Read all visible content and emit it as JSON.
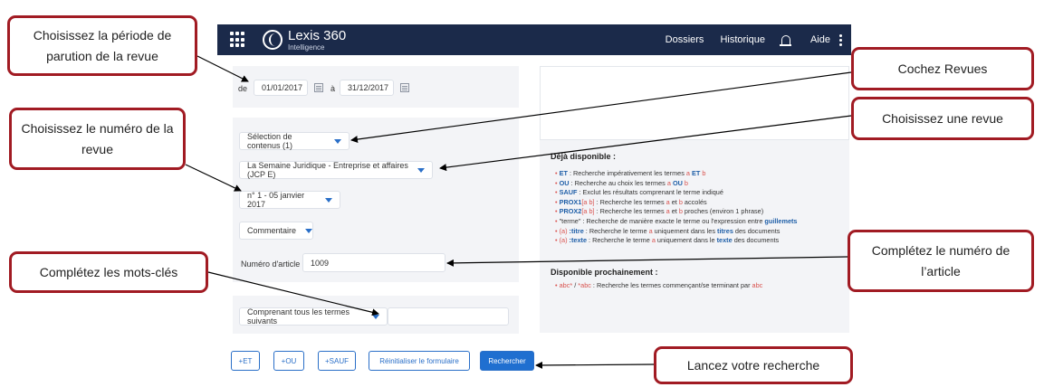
{
  "appbar": {
    "brand": "Lexis 360",
    "subbrand": "Intelligence",
    "nav": [
      "Dossiers",
      "Historique",
      "Aide"
    ]
  },
  "form": {
    "date_from_label": "de",
    "date_from": "01/01/2017",
    "date_to_label": "à",
    "date_to": "31/12/2017",
    "content_select": "Sélection de contenus (1)",
    "revue_select": "La Semaine Juridique - Entreprise et affaires (JCP E)",
    "numero_select": "n° 1 - 05 janvier 2017",
    "type_select": "Commentaire",
    "article_label": "Numéro d'article :",
    "article_value": "1009",
    "terms_select": "Comprenant tous les termes suivants"
  },
  "info": {
    "available_title": "Déjà disponible :",
    "l1_op": "ET",
    "l1_a": " : Recherche impérativement les termes ",
    "l1_x": "a",
    "l1_b": " ",
    "l1_op2": "ET",
    "l1_y": " b",
    "l2_op": "OU",
    "l2_a": " : Recherche au choix les termes ",
    "l2_x": "a",
    "l2_b": " ",
    "l2_op2": "OU",
    "l2_y": " b",
    "l3_op": "SAUF",
    "l3_a": " : Exclut les résultats comprenant le terme indiqué",
    "l4_op": "PROX1",
    "l4_br": "[a b]",
    "l4_a": " : Recherche les termes ",
    "l4_x": "a",
    "l4_b": " et ",
    "l4_y": "b",
    "l4_c": " accolés",
    "l5_op": "PROX2",
    "l5_br": "[a b]",
    "l5_a": " : Recherche les termes ",
    "l5_x": "a",
    "l5_b": " et ",
    "l5_y": "b",
    "l5_c": " proches (environ 1 phrase)",
    "l6_a": "\"terme\" : Recherche de manière exacte le terme ou l'expression entre ",
    "l6_op": "guillemets",
    "l7_x": "(a)",
    "l7_op": " :titre",
    "l7_a": " : Recherche le terme ",
    "l7_y": "a",
    "l7_b": " uniquement dans les ",
    "l7_op2": "titres",
    "l7_c": " des documents",
    "l8_x": "(a)",
    "l8_op": " :texte",
    "l8_a": " : Recherche le terme ",
    "l8_y": "a",
    "l8_b": " uniquement dans le ",
    "l8_op2": "texte",
    "l8_c": " des documents",
    "upcoming_title": "Disponible prochainement :",
    "u1_x": "abc*",
    "u1_a": " / ",
    "u1_y": "*abc",
    "u1_b": " : Recherche les termes commençant/se terminant par ",
    "u1_z": "abc"
  },
  "buttons": {
    "et": "+ET",
    "ou": "+OU",
    "sauf": "+SAUF",
    "reset": "Réinitialiser le formulaire",
    "search": "Rechercher"
  },
  "callouts": {
    "periode": "Choisissez la période de parution de la revue",
    "numero": "Choisissez le numéro de la revue",
    "mots_cles": "Complétez les mots-clés",
    "revues": "Cochez Revues",
    "revue": "Choisissez une revue",
    "article": "Complétez le numéro de l’article",
    "lancez": "Lancez votre recherche"
  },
  "colors": {
    "callout_border": "#a11b23",
    "appbar": "#1b2a4a",
    "accent": "#2a6fc8"
  }
}
